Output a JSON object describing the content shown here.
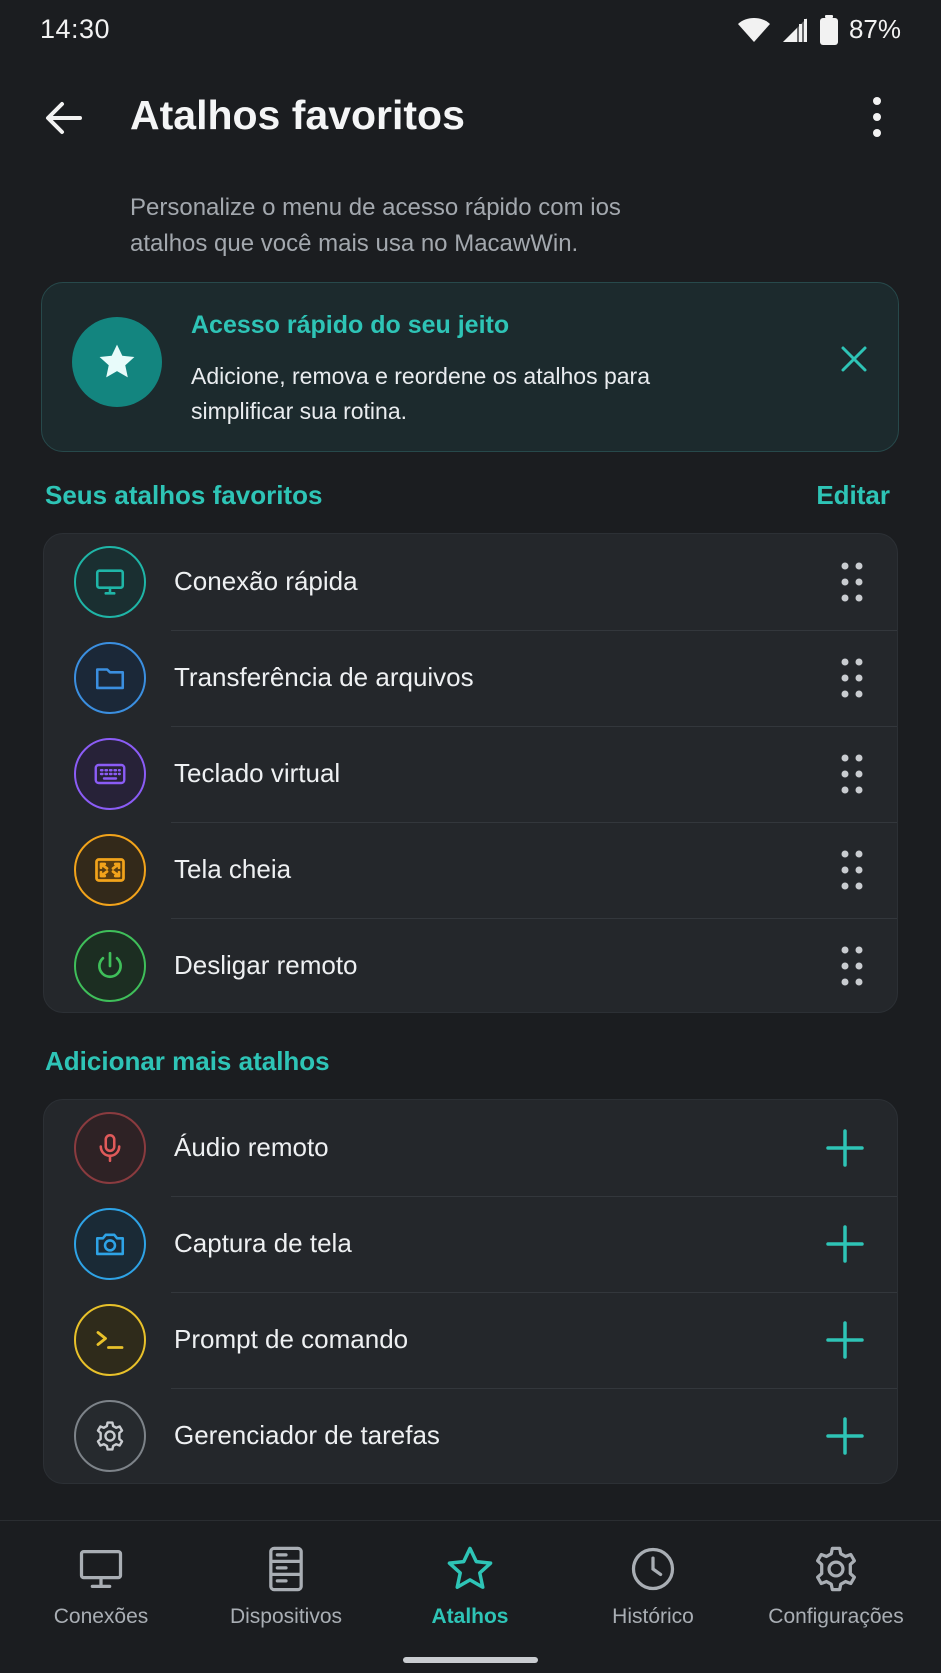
{
  "status_bar": {
    "time": "14:30",
    "battery": "87%",
    "icons": [
      "wifi-icon",
      "signal-icon",
      "battery-icon"
    ]
  },
  "header": {
    "title": "Atalhos favoritos",
    "back_icon": "arrow-left-icon",
    "menu_icon": "more-vertical-icon"
  },
  "subtitle": "Personalize o menu de acesso rápido com ios atalhos que você mais usa no MacawWin.",
  "banner": {
    "icon": "star-icon",
    "title": "Acesso rápido do seu jeito",
    "text": "Adicione, remova e reordene os atalhos para simplificar sua rotina.",
    "close_icon": "close-icon"
  },
  "favorites": {
    "heading": "Seus atalhos favoritos",
    "edit_label": "Editar",
    "items": [
      {
        "label": "Conexão rápida",
        "icon": "monitor-icon",
        "color": "#1fb5a7"
      },
      {
        "label": "Transferência de arquivos",
        "icon": "folder-icon",
        "color": "#3b8fe0"
      },
      {
        "label": "Teclado virtual",
        "icon": "keyboard-icon",
        "color": "#8b5cf6"
      },
      {
        "label": "Tela cheia",
        "icon": "fullscreen-icon",
        "color": "#f2a31b"
      },
      {
        "label": "Desligar remoto",
        "icon": "power-icon",
        "color": "#3fbf5a"
      }
    ]
  },
  "more": {
    "heading": "Adicionar mais atalhos",
    "items": [
      {
        "label": "Áudio remoto",
        "icon": "microphone-icon",
        "color": "#e05a5a"
      },
      {
        "label": "Captura de tela",
        "icon": "camera-icon",
        "color": "#2ea3e6"
      },
      {
        "label": "Prompt de comando",
        "icon": "terminal-icon",
        "color": "#e8c12a"
      },
      {
        "label": "Gerenciador de tarefas",
        "icon": "gear-icon",
        "color": "#9aa0a6"
      }
    ]
  },
  "bottom_nav": {
    "items": [
      {
        "label": "Conexões",
        "icon": "monitor-icon"
      },
      {
        "label": "Dispositivos",
        "icon": "server-icon"
      },
      {
        "label": "Atalhos",
        "icon": "star-icon",
        "active": true
      },
      {
        "label": "Histórico",
        "icon": "clock-icon"
      },
      {
        "label": "Configurações",
        "icon": "gear-icon"
      }
    ]
  },
  "colors": {
    "accent": "#2ec4b6",
    "background": "#1b1d20",
    "card": "#24272b"
  }
}
